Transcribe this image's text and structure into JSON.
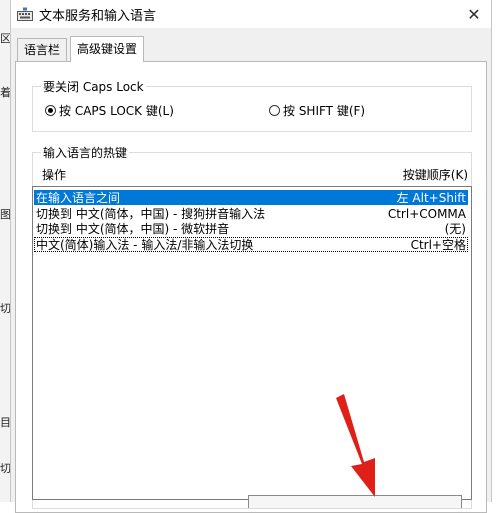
{
  "background": {
    "fragments": [
      "区",
      "着",
      "图",
      "切",
      "目",
      "切"
    ]
  },
  "window": {
    "title": "文本服务和输入语言",
    "close_label": "✕"
  },
  "tabs": [
    {
      "label": "语言栏"
    },
    {
      "label": "高级键设置",
      "active": true
    }
  ],
  "caps_lock": {
    "group_title": "要关闭 Caps Lock",
    "options": [
      {
        "label": "按 CAPS LOCK 键(L)",
        "selected": true
      },
      {
        "label": "按 SHIFT 键(F)",
        "selected": false
      }
    ]
  },
  "hotkeys": {
    "group_title": "输入语言的热键",
    "col_action": "操作",
    "col_keys": "按键顺序(K)",
    "rows": [
      {
        "action": "在输入语言之间",
        "keys": "左 Alt+Shift",
        "selected": true
      },
      {
        "action": "切换到 中文(简体，中国) - 搜狗拼音输入法",
        "keys": "Ctrl+COMMA"
      },
      {
        "action": "切换到 中文(简体，中国) - 微软拼音",
        "keys": "(无)"
      },
      {
        "action": "中文(简体)输入法 - 输入法/非输入法切换",
        "keys": "Ctrl+空格",
        "focused": true
      }
    ]
  },
  "colors": {
    "selection": "#0078d7",
    "arrow": "#e02018"
  },
  "icons": {
    "app": "keyboard-icon",
    "close": "close-icon",
    "annotation": "red-arrow-annotation"
  }
}
